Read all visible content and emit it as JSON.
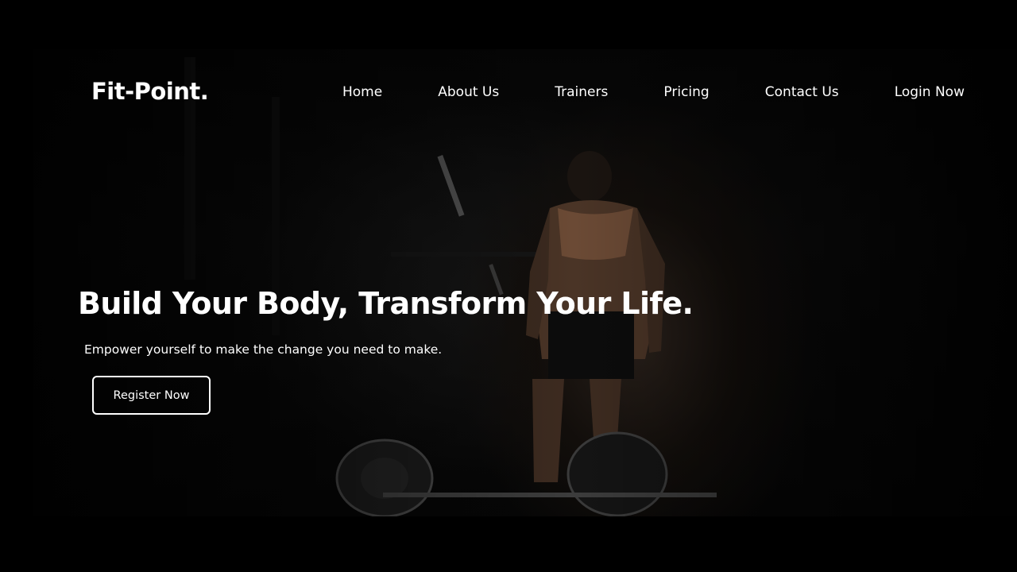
{
  "brand": {
    "logo_text": "Fit-Point."
  },
  "nav": {
    "items": [
      {
        "label": "Home"
      },
      {
        "label": "About Us"
      },
      {
        "label": "Trainers"
      },
      {
        "label": "Pricing"
      },
      {
        "label": "Contact Us"
      },
      {
        "label": "Login Now"
      }
    ]
  },
  "hero": {
    "headline": "Build Your Body, Transform Your Life.",
    "tagline": "Empower yourself to make the change you need to make.",
    "cta_label": "Register Now"
  },
  "colors": {
    "background": "#000000",
    "text": "#ffffff",
    "button_border": "#ffffff"
  }
}
